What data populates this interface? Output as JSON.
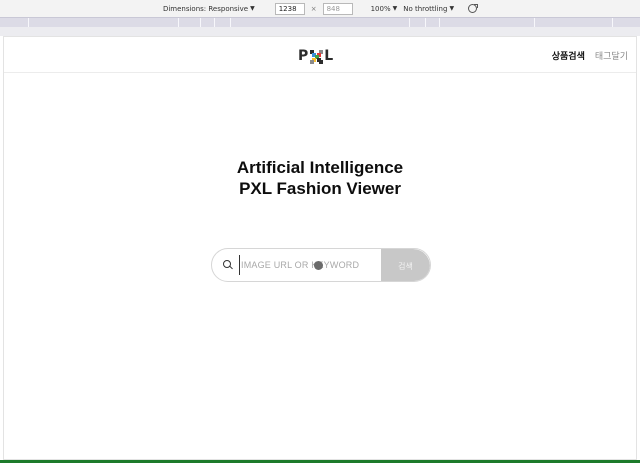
{
  "devtools": {
    "dimensions_label": "Dimensions: Responsive",
    "width_value": "1238",
    "times_sign": "×",
    "height_value": "848",
    "zoom": "100%",
    "throttling": "No throttling"
  },
  "header": {
    "logo_p": "P",
    "logo_l": "L",
    "nav": [
      {
        "label": "상품검색",
        "active": true
      },
      {
        "label": "태그달기",
        "active": false
      }
    ]
  },
  "hero": {
    "line1": "Artificial Intelligence",
    "line2": "PXL Fashion Viewer"
  },
  "search": {
    "placeholder": "IMAGE URL OR KEYWORD",
    "value": "",
    "button_label": "검색"
  },
  "colors": {
    "logo_x": [
      "#2c2c2c",
      "#8b8b8b",
      "#3a8fd8",
      "#e53935",
      "#43a047",
      "#fbc02d",
      "#2c2c2c",
      "#8b8b8b",
      "#2c2c2c"
    ],
    "button": "#c8c8c8",
    "devtools_bottom": "#1d7a2a"
  }
}
